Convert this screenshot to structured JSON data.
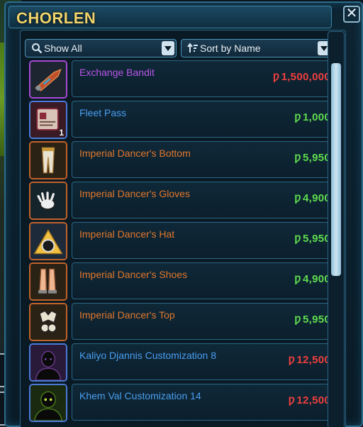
{
  "vendor": {
    "title": "CHORLEN"
  },
  "filters": {
    "show": {
      "label": "Show All",
      "icon": "search-icon"
    },
    "sort": {
      "label": "Sort by Name",
      "icon": "sort-icon"
    }
  },
  "colors": {
    "accent": "#2d6c8a",
    "title": "#f0d36a",
    "rarity_prototype": "#e2782c",
    "rarity_artifact": "#b956e8",
    "rarity_premium": "#4a9ef0",
    "price_affordable": "#5fdc4f",
    "price_unaffordable": "#ef3f3f"
  },
  "currency_symbol": "Ƿ",
  "items": [
    {
      "name": "Exchange Bandit",
      "price": "1,500,000",
      "rarity": "artifact",
      "affordable": false,
      "icon": "speeder-icon",
      "quantity": ""
    },
    {
      "name": "Fleet Pass",
      "price": "1,000",
      "rarity": "premium",
      "affordable": true,
      "icon": "pass-card-icon",
      "quantity": "1"
    },
    {
      "name": "Imperial Dancer's Bottom",
      "price": "5,950",
      "rarity": "prototype",
      "affordable": true,
      "icon": "pants-icon",
      "quantity": ""
    },
    {
      "name": "Imperial Dancer's Gloves",
      "price": "4,900",
      "rarity": "prototype",
      "affordable": true,
      "icon": "gloves-icon",
      "quantity": ""
    },
    {
      "name": "Imperial Dancer's Hat",
      "price": "5,950",
      "rarity": "prototype",
      "affordable": true,
      "icon": "hat-icon",
      "quantity": ""
    },
    {
      "name": "Imperial Dancer's Shoes",
      "price": "4,900",
      "rarity": "prototype",
      "affordable": true,
      "icon": "boots-icon",
      "quantity": ""
    },
    {
      "name": "Imperial Dancer's Top",
      "price": "5,950",
      "rarity": "prototype",
      "affordable": true,
      "icon": "top-icon",
      "quantity": ""
    },
    {
      "name": "Kaliyo Djannis Customization 8",
      "price": "12,500",
      "rarity": "premium",
      "affordable": false,
      "icon": "silhouette-icon",
      "quantity": ""
    },
    {
      "name": "Khem Val Customization 14",
      "price": "12,500",
      "rarity": "premium",
      "affordable": false,
      "icon": "silhouette-icon",
      "quantity": ""
    }
  ]
}
